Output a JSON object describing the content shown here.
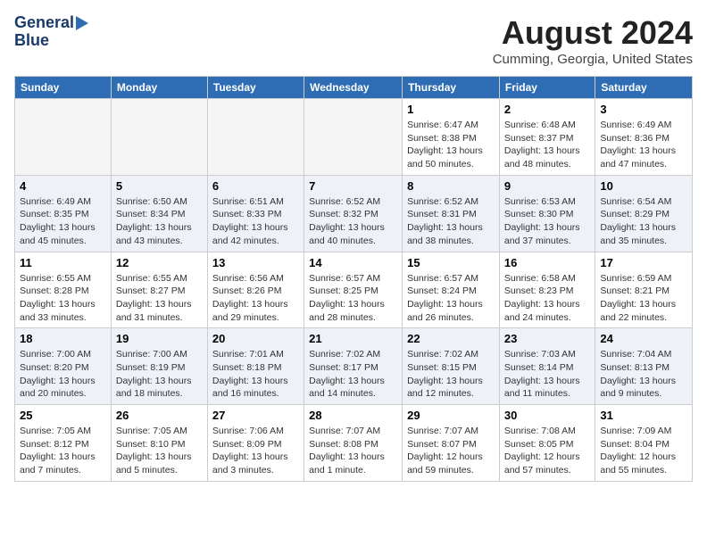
{
  "header": {
    "logo_line1": "General",
    "logo_line2": "Blue",
    "title": "August 2024",
    "subtitle": "Cumming, Georgia, United States"
  },
  "days_of_week": [
    "Sunday",
    "Monday",
    "Tuesday",
    "Wednesday",
    "Thursday",
    "Friday",
    "Saturday"
  ],
  "weeks": [
    [
      {
        "day": "",
        "empty": true
      },
      {
        "day": "",
        "empty": true
      },
      {
        "day": "",
        "empty": true
      },
      {
        "day": "",
        "empty": true
      },
      {
        "day": "1",
        "sunrise": "6:47 AM",
        "sunset": "8:38 PM",
        "daylight": "13 hours and 50 minutes."
      },
      {
        "day": "2",
        "sunrise": "6:48 AM",
        "sunset": "8:37 PM",
        "daylight": "13 hours and 48 minutes."
      },
      {
        "day": "3",
        "sunrise": "6:49 AM",
        "sunset": "8:36 PM",
        "daylight": "13 hours and 47 minutes."
      }
    ],
    [
      {
        "day": "4",
        "sunrise": "6:49 AM",
        "sunset": "8:35 PM",
        "daylight": "13 hours and 45 minutes."
      },
      {
        "day": "5",
        "sunrise": "6:50 AM",
        "sunset": "8:34 PM",
        "daylight": "13 hours and 43 minutes."
      },
      {
        "day": "6",
        "sunrise": "6:51 AM",
        "sunset": "8:33 PM",
        "daylight": "13 hours and 42 minutes."
      },
      {
        "day": "7",
        "sunrise": "6:52 AM",
        "sunset": "8:32 PM",
        "daylight": "13 hours and 40 minutes."
      },
      {
        "day": "8",
        "sunrise": "6:52 AM",
        "sunset": "8:31 PM",
        "daylight": "13 hours and 38 minutes."
      },
      {
        "day": "9",
        "sunrise": "6:53 AM",
        "sunset": "8:30 PM",
        "daylight": "13 hours and 37 minutes."
      },
      {
        "day": "10",
        "sunrise": "6:54 AM",
        "sunset": "8:29 PM",
        "daylight": "13 hours and 35 minutes."
      }
    ],
    [
      {
        "day": "11",
        "sunrise": "6:55 AM",
        "sunset": "8:28 PM",
        "daylight": "13 hours and 33 minutes."
      },
      {
        "day": "12",
        "sunrise": "6:55 AM",
        "sunset": "8:27 PM",
        "daylight": "13 hours and 31 minutes."
      },
      {
        "day": "13",
        "sunrise": "6:56 AM",
        "sunset": "8:26 PM",
        "daylight": "13 hours and 29 minutes."
      },
      {
        "day": "14",
        "sunrise": "6:57 AM",
        "sunset": "8:25 PM",
        "daylight": "13 hours and 28 minutes."
      },
      {
        "day": "15",
        "sunrise": "6:57 AM",
        "sunset": "8:24 PM",
        "daylight": "13 hours and 26 minutes."
      },
      {
        "day": "16",
        "sunrise": "6:58 AM",
        "sunset": "8:23 PM",
        "daylight": "13 hours and 24 minutes."
      },
      {
        "day": "17",
        "sunrise": "6:59 AM",
        "sunset": "8:21 PM",
        "daylight": "13 hours and 22 minutes."
      }
    ],
    [
      {
        "day": "18",
        "sunrise": "7:00 AM",
        "sunset": "8:20 PM",
        "daylight": "13 hours and 20 minutes."
      },
      {
        "day": "19",
        "sunrise": "7:00 AM",
        "sunset": "8:19 PM",
        "daylight": "13 hours and 18 minutes."
      },
      {
        "day": "20",
        "sunrise": "7:01 AM",
        "sunset": "8:18 PM",
        "daylight": "13 hours and 16 minutes."
      },
      {
        "day": "21",
        "sunrise": "7:02 AM",
        "sunset": "8:17 PM",
        "daylight": "13 hours and 14 minutes."
      },
      {
        "day": "22",
        "sunrise": "7:02 AM",
        "sunset": "8:15 PM",
        "daylight": "13 hours and 12 minutes."
      },
      {
        "day": "23",
        "sunrise": "7:03 AM",
        "sunset": "8:14 PM",
        "daylight": "13 hours and 11 minutes."
      },
      {
        "day": "24",
        "sunrise": "7:04 AM",
        "sunset": "8:13 PM",
        "daylight": "13 hours and 9 minutes."
      }
    ],
    [
      {
        "day": "25",
        "sunrise": "7:05 AM",
        "sunset": "8:12 PM",
        "daylight": "13 hours and 7 minutes."
      },
      {
        "day": "26",
        "sunrise": "7:05 AM",
        "sunset": "8:10 PM",
        "daylight": "13 hours and 5 minutes."
      },
      {
        "day": "27",
        "sunrise": "7:06 AM",
        "sunset": "8:09 PM",
        "daylight": "13 hours and 3 minutes."
      },
      {
        "day": "28",
        "sunrise": "7:07 AM",
        "sunset": "8:08 PM",
        "daylight": "13 hours and 1 minute."
      },
      {
        "day": "29",
        "sunrise": "7:07 AM",
        "sunset": "8:07 PM",
        "daylight": "12 hours and 59 minutes."
      },
      {
        "day": "30",
        "sunrise": "7:08 AM",
        "sunset": "8:05 PM",
        "daylight": "12 hours and 57 minutes."
      },
      {
        "day": "31",
        "sunrise": "7:09 AM",
        "sunset": "8:04 PM",
        "daylight": "12 hours and 55 minutes."
      }
    ]
  ],
  "labels": {
    "sunrise": "Sunrise:",
    "sunset": "Sunset:",
    "daylight": "Daylight:"
  }
}
